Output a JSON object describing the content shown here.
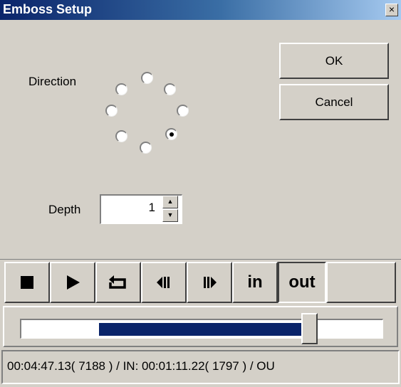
{
  "window": {
    "title": "Emboss Setup",
    "close_glyph": "×"
  },
  "dialog": {
    "direction_label": "Direction",
    "direction_options": [
      "N",
      "NE",
      "E",
      "SE",
      "S",
      "SW",
      "W",
      "NW"
    ],
    "direction_selected": "SE",
    "depth_label": "Depth",
    "depth_value": "1",
    "ok_label": "OK",
    "cancel_label": "Cancel"
  },
  "transport": {
    "buttons": [
      {
        "name": "stop",
        "icon": "stop-icon"
      },
      {
        "name": "play",
        "icon": "play-icon"
      },
      {
        "name": "loop",
        "icon": "loop-icon"
      },
      {
        "name": "step-back",
        "icon": "step-back-icon"
      },
      {
        "name": "step-forward",
        "icon": "step-forward-icon"
      },
      {
        "name": "in",
        "label": "in"
      },
      {
        "name": "out",
        "label": "out",
        "active": true
      }
    ]
  },
  "timeline": {
    "in_fraction": 0.215,
    "position_fraction": 0.78,
    "fill_color": "#0a246a"
  },
  "status": {
    "text": "00:04:47.13( 7188 ) / IN: 00:01:11.22( 1797 ) / OU"
  }
}
